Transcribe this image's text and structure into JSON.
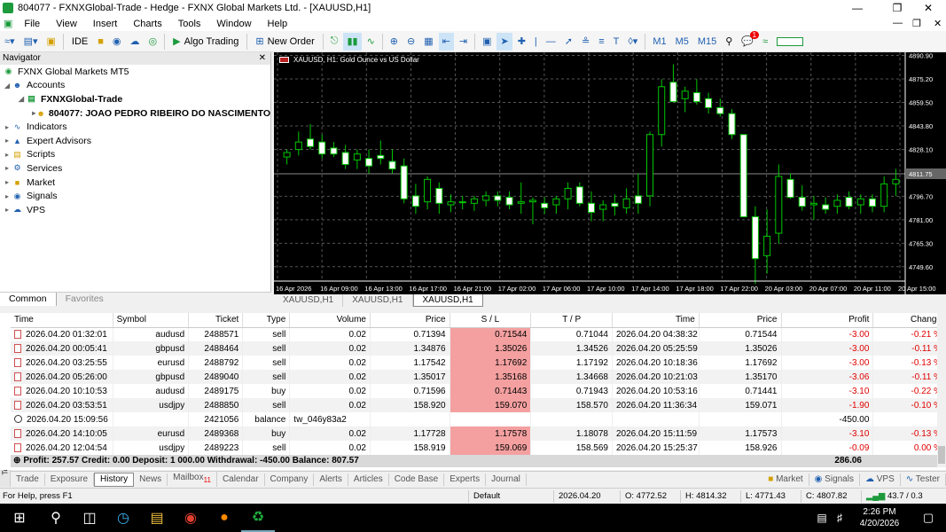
{
  "window": {
    "title": "804077 - FXNXGlobal-Trade - Hedge - FXNX Global Markets Ltd. - [XAUUSD,H1]"
  },
  "menu": [
    "File",
    "View",
    "Insert",
    "Charts",
    "Tools",
    "Window",
    "Help"
  ],
  "toolbar": {
    "ide": "IDE",
    "algo": "Algo Trading",
    "new_order": "New Order",
    "tf": [
      "M1",
      "M5",
      "M15"
    ],
    "notif": "1"
  },
  "navigator": {
    "title": "Navigator",
    "root": "FXNX Global Markets MT5",
    "accounts": "Accounts",
    "server": "FXNXGlobal-Trade",
    "account": "804077: JOAO PEDRO RIBEIRO DO NASCIMENTO",
    "items": [
      "Indicators",
      "Expert Advisors",
      "Scripts",
      "Services",
      "Market",
      "Signals",
      "VPS"
    ],
    "tabs": [
      "Common",
      "Favorites"
    ]
  },
  "chart": {
    "label": "XAUUSD, H1:  Gold Ounce vs US Dollar",
    "prices": [
      "4890.90",
      "4875.20",
      "4859.50",
      "4843.80",
      "4828.10",
      "4811.75",
      "4796.70",
      "4781.00",
      "4765.30",
      "4749.60"
    ],
    "times": [
      "16 Apr 2026",
      "16 Apr 09:00",
      "16 Apr 13:00",
      "16 Apr 17:00",
      "16 Apr 21:00",
      "17 Apr 02:00",
      "17 Apr 06:00",
      "17 Apr 10:00",
      "17 Apr 14:00",
      "17 Apr 18:00",
      "17 Apr 22:00",
      "20 Apr 03:00",
      "20 Apr 07:00",
      "20 Apr 11:00",
      "20 Apr 15:00"
    ],
    "current": "4811.75"
  },
  "chart_tabs": [
    "XAUUSD,H1",
    "XAUUSD,H1",
    "XAUUSD,H1"
  ],
  "history": {
    "columns": [
      "Time",
      "Symbol",
      "Ticket",
      "Type",
      "Volume",
      "Price",
      "S / L",
      "T / P",
      "Time",
      "Price",
      "Profit",
      "Change"
    ],
    "rows": [
      [
        "2026.04.20 01:32:01",
        "audusd",
        "2488571",
        "sell",
        "0.02",
        "0.71394",
        "0.71544",
        "0.71044",
        "2026.04.20 04:38:32",
        "0.71544",
        "-3.00",
        "-0.21 %"
      ],
      [
        "2026.04.20 00:05:41",
        "gbpusd",
        "2488464",
        "sell",
        "0.02",
        "1.34876",
        "1.35026",
        "1.34526",
        "2026.04.20 05:25:59",
        "1.35026",
        "-3.00",
        "-0.11 %"
      ],
      [
        "2026.04.20 03:25:55",
        "eurusd",
        "2488792",
        "sell",
        "0.02",
        "1.17542",
        "1.17692",
        "1.17192",
        "2026.04.20 10:18:36",
        "1.17692",
        "-3.00",
        "-0.13 %"
      ],
      [
        "2026.04.20 05:26:00",
        "gbpusd",
        "2489040",
        "sell",
        "0.02",
        "1.35017",
        "1.35168",
        "1.34668",
        "2026.04.20 10:21:03",
        "1.35170",
        "-3.06",
        "-0.11 %"
      ],
      [
        "2026.04.20 10:10:53",
        "audusd",
        "2489175",
        "buy",
        "0.02",
        "0.71596",
        "0.71443",
        "0.71943",
        "2026.04.20 10:53:16",
        "0.71441",
        "-3.10",
        "-0.22 %"
      ],
      [
        "2026.04.20 03:53:51",
        "usdjpy",
        "2488850",
        "sell",
        "0.02",
        "158.920",
        "159.070",
        "158.570",
        "2026.04.20 11:36:34",
        "159.071",
        "-1.90",
        "-0.10 %"
      ],
      [
        "2026.04.20 15:09:56",
        "",
        "2421056",
        "balance",
        "tw_046y83a2",
        "",
        "",
        "",
        "",
        "",
        "-450.00",
        ""
      ],
      [
        "2026.04.20 14:10:05",
        "eurusd",
        "2489368",
        "buy",
        "0.02",
        "1.17728",
        "1.17578",
        "1.18078",
        "2026.04.20 15:11:59",
        "1.17573",
        "-3.10",
        "-0.13 %"
      ],
      [
        "2026.04.20 12:04:54",
        "usdjpy",
        "2489223",
        "sell",
        "0.02",
        "158.919",
        "159.069",
        "158.569",
        "2026.04.20 15:25:37",
        "158.926",
        "-0.09",
        "0.00 %"
      ]
    ],
    "summary": "Profit: 257.57  Credit: 0.00  Deposit: 1 000.00  Withdrawal: -450.00  Balance: 807.57",
    "summary_total": "286.06"
  },
  "terminal_tabs": [
    "Trade",
    "Exposure",
    "History",
    "News",
    "Mailbox",
    "Calendar",
    "Company",
    "Alerts",
    "Articles",
    "Code Base",
    "Experts",
    "Journal"
  ],
  "mailbox_badge": "11",
  "terminal_right": [
    "Market",
    "Signals",
    "VPS",
    "Tester"
  ],
  "toolbox_label": "Toolbox",
  "status": {
    "help": "For Help, press F1",
    "profile": "Default",
    "datetime": "2026.04.20 04:00",
    "o": "O: 4772.52",
    "h": "H: 4814.32",
    "l": "L: 4771.43",
    "c": "C: 4807.82",
    "traffic": "43.7 / 0.3 Mb"
  },
  "taskbar": {
    "time": "2:26 PM",
    "date": "4/20/2026"
  },
  "colors": {
    "bull": "#00c800",
    "bear": "#ffffff",
    "chart_bg": "#000000",
    "sl_hit": "#f4a0a0"
  }
}
